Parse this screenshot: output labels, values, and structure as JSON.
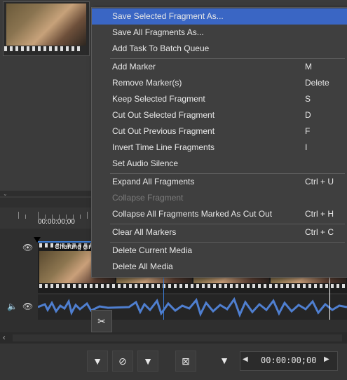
{
  "timeline": {
    "ruler_time": "00:00:00;00",
    "clip_name": "Charting girl",
    "scissors_icon": "scissors-icon"
  },
  "toolbar": {
    "time_value": "00:00:00;00",
    "prev_icon": "chevron-left-icon",
    "next_icon": "chevron-right-icon"
  },
  "menu": {
    "items": [
      {
        "label": "Save Selected Fragment As...",
        "shortcut": "",
        "highlighted": true
      },
      {
        "label": "Save All Fragments As...",
        "shortcut": ""
      },
      {
        "label": "Add Task To Batch Queue",
        "shortcut": ""
      },
      {
        "label": "Add Marker",
        "shortcut": "M"
      },
      {
        "label": "Remove Marker(s)",
        "shortcut": "Delete"
      },
      {
        "label": "Keep Selected Fragment",
        "shortcut": "S"
      },
      {
        "label": "Cut Out Selected Fragment",
        "shortcut": "D"
      },
      {
        "label": "Cut Out Previous Fragment",
        "shortcut": "F"
      },
      {
        "label": "Invert Time Line Fragments",
        "shortcut": "I"
      },
      {
        "label": "Set Audio Silence",
        "shortcut": ""
      },
      {
        "label": "Expand All Fragments",
        "shortcut": "Ctrl + U"
      },
      {
        "label": "Collapse Fragment",
        "shortcut": "",
        "disabled": true
      },
      {
        "label": "Collapse All Fragments Marked As Cut Out",
        "shortcut": "Ctrl + H"
      },
      {
        "label": "Clear All Markers",
        "shortcut": "Ctrl + C"
      },
      {
        "label": "Delete Current Media",
        "shortcut": ""
      },
      {
        "label": "Delete All Media",
        "shortcut": ""
      }
    ]
  },
  "colors": {
    "highlight": "#3a66c4",
    "menu_bg": "#3f3f3f",
    "waveform": "#4f7fd0"
  }
}
